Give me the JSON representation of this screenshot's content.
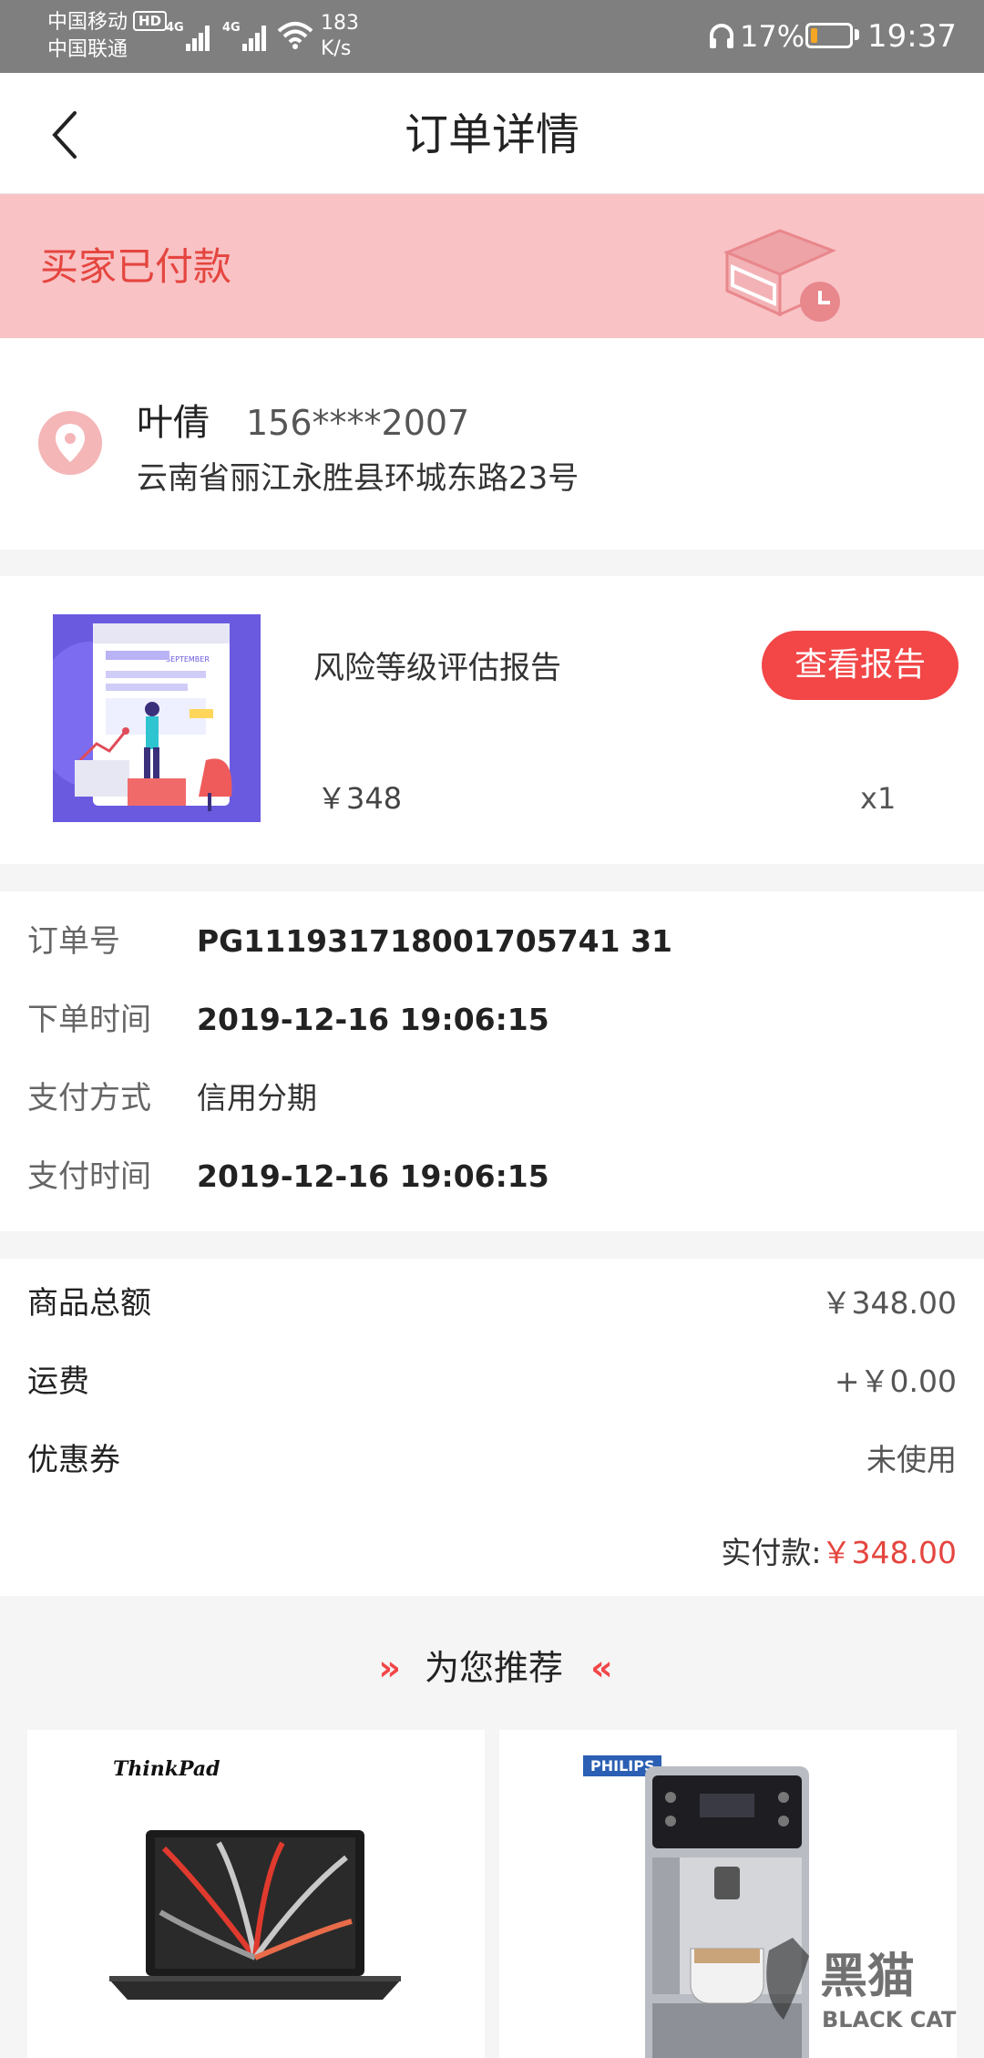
{
  "status_bar": {
    "carrier1": "中国移动",
    "hd": "HD",
    "carrier2": "中国联通",
    "net1": "4G",
    "net2": "4G",
    "speed_value": "183",
    "speed_unit": "K/s",
    "battery": "17%",
    "battery_level": 0.17,
    "time": "19:37"
  },
  "header": {
    "title": "订单详情",
    "back_icon": "chevron-left-icon"
  },
  "banner": {
    "status": "买家已付款",
    "icon": "package-clock-icon",
    "bg_color": "#f9c2c5",
    "text_color": "#e5453f"
  },
  "address": {
    "icon": "location-pin-icon",
    "name": "叶倩",
    "phone": "156****2007",
    "detail": "云南省丽江永胜县环城东路23号"
  },
  "product": {
    "name": "风险等级评估报告",
    "button": "查看报告",
    "price": "￥348",
    "qty": "x1",
    "image_text": "SEPTEMBER",
    "accent": "#f24647"
  },
  "order_info": [
    {
      "label": "订单号",
      "value": "PG111931718001705741 31",
      "bold": true
    },
    {
      "label": "下单时间",
      "value": "2019-12-16 19:06:15",
      "bold": true
    },
    {
      "label": "支付方式",
      "value": "信用分期",
      "bold": false
    },
    {
      "label": "支付时间",
      "value": "2019-12-16 19:06:15",
      "bold": true
    }
  ],
  "amounts": {
    "rows": [
      {
        "label": "商品总额",
        "value": "￥348.00"
      },
      {
        "label": "运费",
        "value": "+￥0.00"
      },
      {
        "label": "优惠券",
        "value": "未使用"
      }
    ],
    "paid_label": "实付款:",
    "paid_value": "￥348.00"
  },
  "recommend": {
    "title": "为您推荐",
    "chevron_left": "»",
    "chevron_right": "«",
    "items": [
      {
        "brand": "ThinkPad"
      },
      {
        "brand": "PHILIPS"
      }
    ]
  },
  "watermark": {
    "cn": "黑猫",
    "en": "BLACK CAT"
  }
}
